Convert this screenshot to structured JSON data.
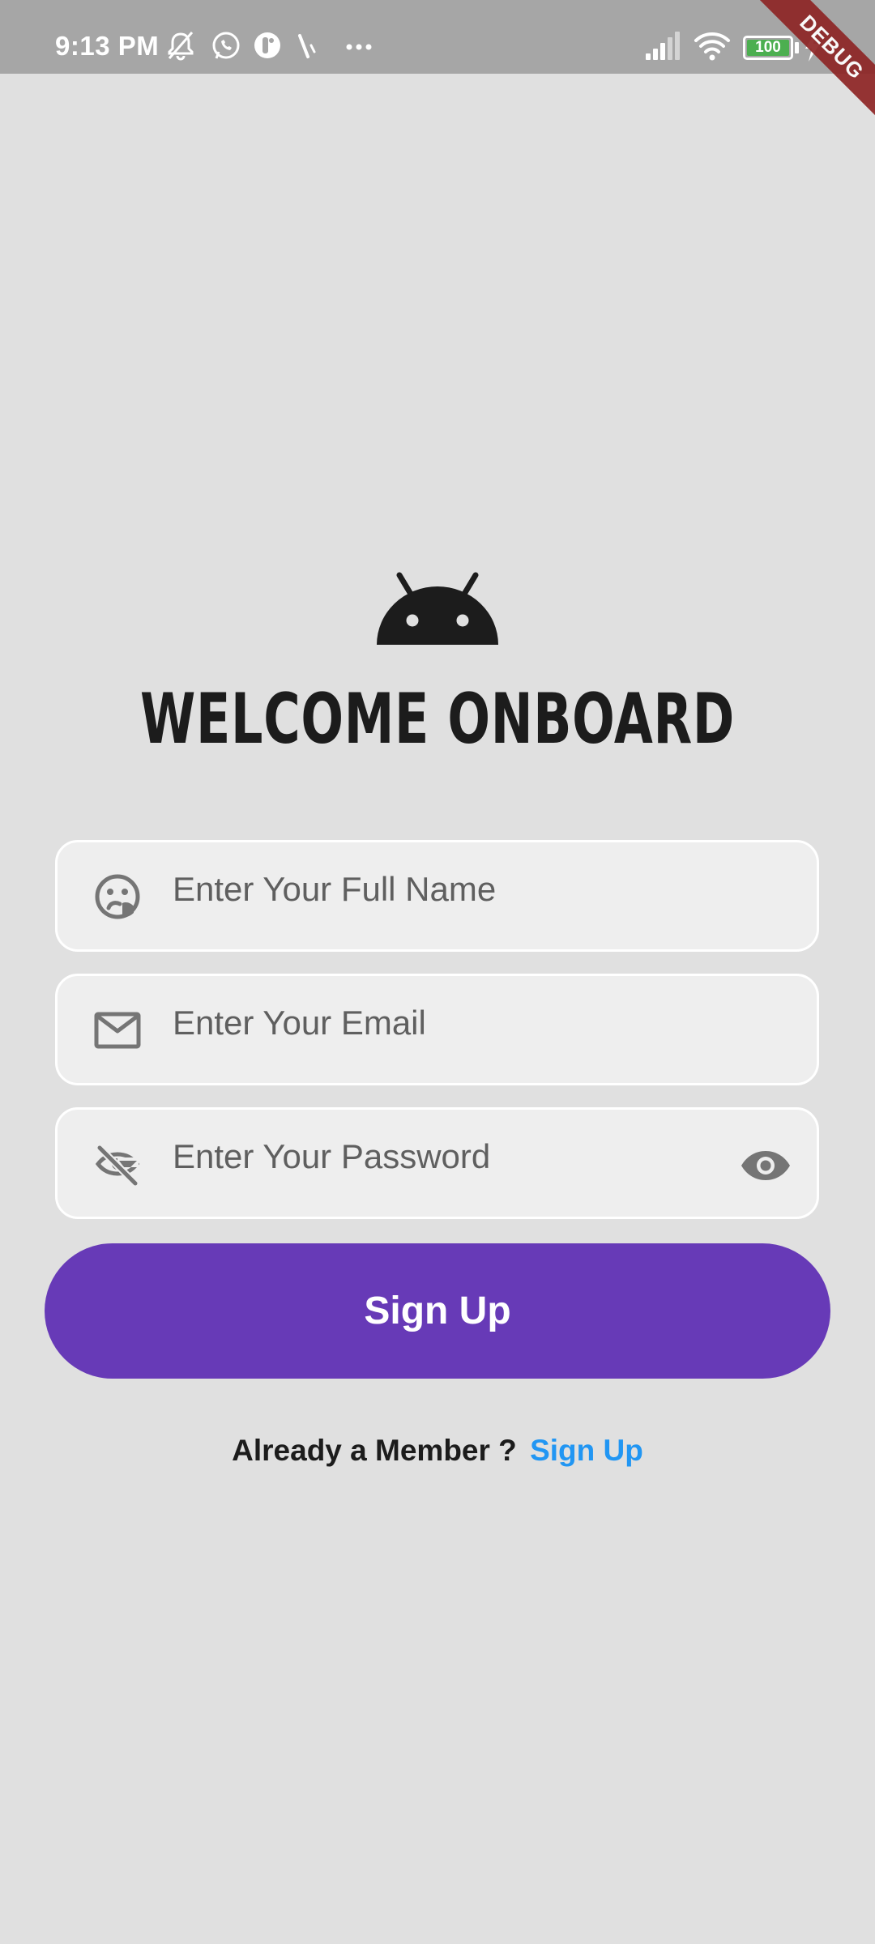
{
  "status_bar": {
    "time": "9:13 PM",
    "battery_level": "100",
    "icons": [
      "mute-icon",
      "whatsapp-icon",
      "app-icon",
      "signal-mark-icon",
      "more-dots-icon",
      "cellular-signal-icon",
      "wifi-icon",
      "battery-icon",
      "charging-icon"
    ],
    "battery_color": "#4caf50"
  },
  "debug_banner": "DEBUG",
  "header": {
    "logo_icon": "android-icon",
    "title": "WELCOME ONBOARD"
  },
  "form": {
    "full_name": {
      "placeholder": "Enter Your Full Name",
      "icon": "face-icon",
      "value": ""
    },
    "email": {
      "placeholder": "Enter Your Email",
      "icon": "mail-icon",
      "value": ""
    },
    "password": {
      "placeholder": "Enter Your Password",
      "icon": "visibility-off-icon",
      "value": "",
      "toggle_icon": "eye-icon"
    },
    "submit_label": "Sign Up"
  },
  "footer": {
    "prompt": "Already a Member ?",
    "link": "Sign Up"
  },
  "colors": {
    "background": "#e0e0e0",
    "accent": "#673ab7",
    "link": "#2196f3",
    "status_bar": "#a6a6a6"
  }
}
